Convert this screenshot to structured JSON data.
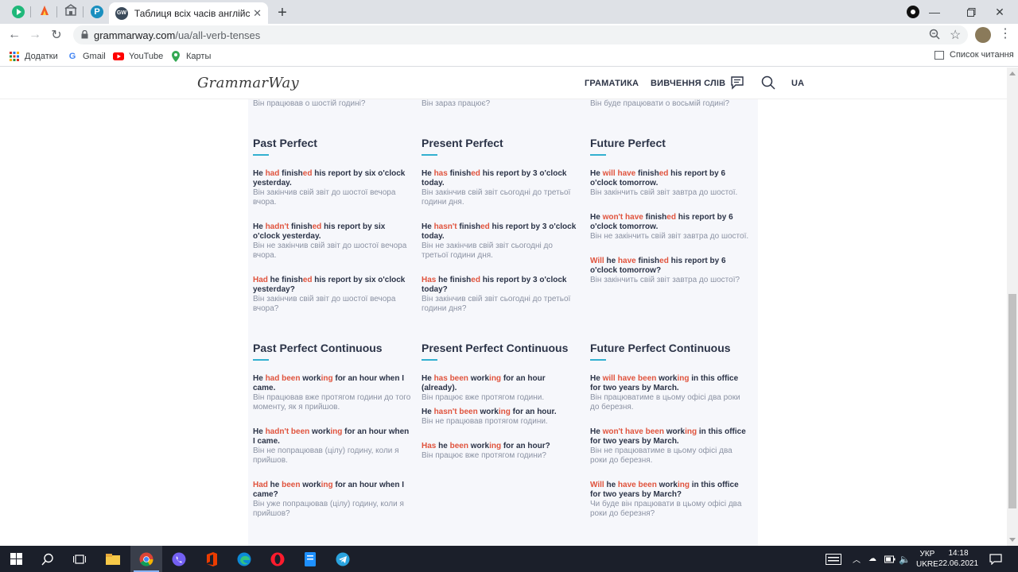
{
  "browser": {
    "tab_title": "Таблиця всіх часів англійської м",
    "tab_favicon": "GW",
    "url_host": "grammarway.com",
    "url_path": "/ua/all-verb-tenses",
    "bookmarks": [
      "Додатки",
      "Gmail",
      "YouTube",
      "Карты"
    ],
    "reading_list": "Список читання"
  },
  "site": {
    "logo": "GrammarWay",
    "nav": [
      "ГРАМАТИКА",
      "ВИВЧЕННЯ СЛІВ"
    ],
    "lang": "UA"
  },
  "prev_row": [
    "Він працював о шостій годині?",
    "Він зараз працює?",
    "Він буде працювати о восьмій годині?"
  ],
  "sections": [
    {
      "title": "Past Perfect",
      "examples": [
        {
          "en": [
            [
              "He ",
              0
            ],
            [
              "had",
              1
            ],
            [
              " finish",
              0
            ],
            [
              "ed",
              1
            ],
            [
              " his report by six o'clock yesterday.",
              0
            ]
          ],
          "uk": "Він закінчив свій звіт до шостої вечора вчора."
        },
        {
          "en": [
            [
              "He ",
              0
            ],
            [
              "hadn't",
              1
            ],
            [
              " finish",
              0
            ],
            [
              "ed",
              1
            ],
            [
              " his report by six o'clock yesterday.",
              0
            ]
          ],
          "uk": "Він не закінчив свій звіт до шостої вечора вчора."
        },
        {
          "en": [
            [
              "Had",
              1
            ],
            [
              " he finish",
              0
            ],
            [
              "ed",
              1
            ],
            [
              " his report by six o'clock yesterday?",
              0
            ]
          ],
          "uk": "Він закінчив свій звіт до шостої вечора вчора?"
        }
      ]
    },
    {
      "title": "Present Perfect",
      "examples": [
        {
          "en": [
            [
              "He ",
              0
            ],
            [
              "has",
              1
            ],
            [
              " finish",
              0
            ],
            [
              "ed",
              1
            ],
            [
              " his report by 3 o'clock today.",
              0
            ]
          ],
          "uk": "Він закінчив свій звіт сьогодні до третьої години дня."
        },
        {
          "en": [
            [
              "He ",
              0
            ],
            [
              "hasn't",
              1
            ],
            [
              " finish",
              0
            ],
            [
              "ed",
              1
            ],
            [
              " his report by 3 o'clock today.",
              0
            ]
          ],
          "uk": "Він не закінчив свій звіт сьогодні до третьої години дня."
        },
        {
          "en": [
            [
              "Has",
              1
            ],
            [
              " he finish",
              0
            ],
            [
              "ed",
              1
            ],
            [
              " his report by 3 o'clock today?",
              0
            ]
          ],
          "uk": "Він закінчив свій звіт сьогодні до третьої години дня?"
        }
      ]
    },
    {
      "title": "Future Perfect",
      "examples": [
        {
          "en": [
            [
              "He ",
              0
            ],
            [
              "will have",
              1
            ],
            [
              " finish",
              0
            ],
            [
              "ed",
              1
            ],
            [
              " his report by 6 o'clock tomorrow.",
              0
            ]
          ],
          "uk": "Він закінчить свій звіт завтра до шостої."
        },
        {
          "en": [
            [
              "He ",
              0
            ],
            [
              "won't have",
              1
            ],
            [
              " finish",
              0
            ],
            [
              "ed",
              1
            ],
            [
              " his report by 6 o'clock tomorrow.",
              0
            ]
          ],
          "uk": "Він не закінчить свій звіт завтра до шостої."
        },
        {
          "en": [
            [
              "Will",
              1
            ],
            [
              " he ",
              0
            ],
            [
              "have",
              1
            ],
            [
              " finish",
              0
            ],
            [
              "ed",
              1
            ],
            [
              " his report by 6 o'clock tomorrow?",
              0
            ]
          ],
          "uk": "Він закінчить свій звіт завтра до шостої?"
        }
      ]
    },
    {
      "title": "Past Perfect Continuous",
      "examples": [
        {
          "en": [
            [
              "He ",
              0
            ],
            [
              "had been",
              1
            ],
            [
              " work",
              0
            ],
            [
              "ing",
              1
            ],
            [
              " for an hour when I came.",
              0
            ]
          ],
          "uk": "Він працював вже протягом години до того моменту, як я прийшов."
        },
        {
          "en": [
            [
              "He ",
              0
            ],
            [
              "hadn't been",
              1
            ],
            [
              " work",
              0
            ],
            [
              "ing",
              1
            ],
            [
              " for an hour when I came.",
              0
            ]
          ],
          "uk": "Він не попрацював (цілу) годину, коли я прийшов."
        },
        {
          "en": [
            [
              "Had",
              1
            ],
            [
              " he ",
              0
            ],
            [
              "been",
              1
            ],
            [
              " work",
              0
            ],
            [
              "ing",
              1
            ],
            [
              " for an hour when I came?",
              0
            ]
          ],
          "uk": "Він уже попрацював (цілу) годину, коли я прийшов?"
        }
      ]
    },
    {
      "title": "Present Perfect Continuous",
      "examples": [
        {
          "en": [
            [
              "He ",
              0
            ],
            [
              "has been",
              1
            ],
            [
              " work",
              0
            ],
            [
              "ing",
              1
            ],
            [
              " for an hour (already).",
              0
            ]
          ],
          "uk": "Він працює вже протягом години."
        },
        {
          "en": [
            [
              "He ",
              0
            ],
            [
              "hasn't been",
              1
            ],
            [
              " work",
              0
            ],
            [
              "ing",
              1
            ],
            [
              " for an hour.",
              0
            ]
          ],
          "uk": "Він не працював протягом години."
        },
        {
          "en": [
            [
              "Has",
              1
            ],
            [
              " he ",
              0
            ],
            [
              "been",
              1
            ],
            [
              " work",
              0
            ],
            [
              "ing",
              1
            ],
            [
              " for an hour?",
              0
            ]
          ],
          "uk": "Він працює вже протягом години?"
        }
      ]
    },
    {
      "title": "Future Perfect Continuous",
      "examples": [
        {
          "en": [
            [
              "He ",
              0
            ],
            [
              "will have been",
              1
            ],
            [
              " work",
              0
            ],
            [
              "ing",
              1
            ],
            [
              " in this office for two years by March.",
              0
            ]
          ],
          "uk": "Він працюватиме в цьому офісі два роки до березня."
        },
        {
          "en": [
            [
              "He ",
              0
            ],
            [
              "won't have been",
              1
            ],
            [
              " work",
              0
            ],
            [
              "ing",
              1
            ],
            [
              " in this office for two years by March.",
              0
            ]
          ],
          "uk": "Він не працюватиме в цьому офісі два роки до березня."
        },
        {
          "en": [
            [
              "Will",
              1
            ],
            [
              " he ",
              0
            ],
            [
              "have been",
              1
            ],
            [
              " work",
              0
            ],
            [
              "ing",
              1
            ],
            [
              " in this office for two years by March?",
              0
            ]
          ],
          "uk": "Чи буде він працювати в цьому офісі два роки до березня?"
        }
      ]
    }
  ],
  "taskbar": {
    "lang_top": "УКР",
    "lang_bottom": "UKRE",
    "time": "14:18",
    "date": "22.06.2021"
  },
  "colors": {
    "accent": "#e0533d",
    "underline": "#33b0d0",
    "heading": "#2b3347",
    "translation": "#8b92a3"
  }
}
